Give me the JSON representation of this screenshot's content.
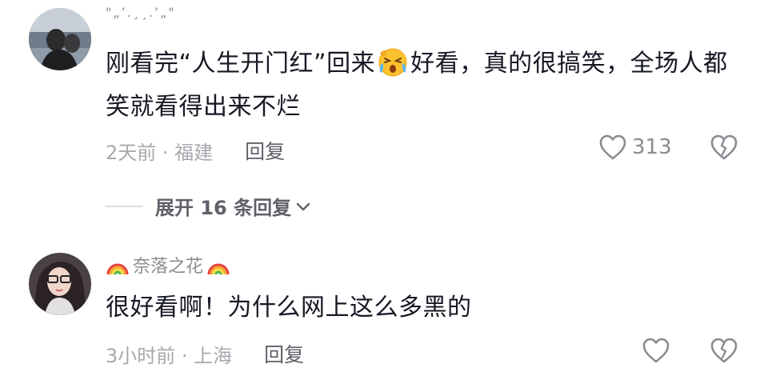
{
  "comments": [
    {
      "username": "\"„’.¸ˏ.’„\"",
      "text_before_emoji": "刚看完“人生开门红”回来",
      "emoji": "crying-laughing-face",
      "text_after_emoji": "好看，真的很搞笑，全场人都笑就看得出来不烂",
      "time_location": "2天前 · 福建",
      "reply_label": "回复",
      "like_count": "313"
    },
    {
      "username": "奈落之花",
      "username_decoration": "rainbow-icon",
      "text": "很好看啊！为什么网上这么多黑的",
      "time_location": "3小时前 · 上海",
      "reply_label": "回复",
      "like_count": ""
    }
  ],
  "expand_replies_label": "展开 16 条回复",
  "icons": {
    "like": "heart-outline-icon",
    "dislike": "broken-heart-icon",
    "expand": "chevron-down-icon"
  },
  "colors": {
    "text": "#161823",
    "secondary": "#a7a8ad",
    "reply": "#5f6068"
  }
}
